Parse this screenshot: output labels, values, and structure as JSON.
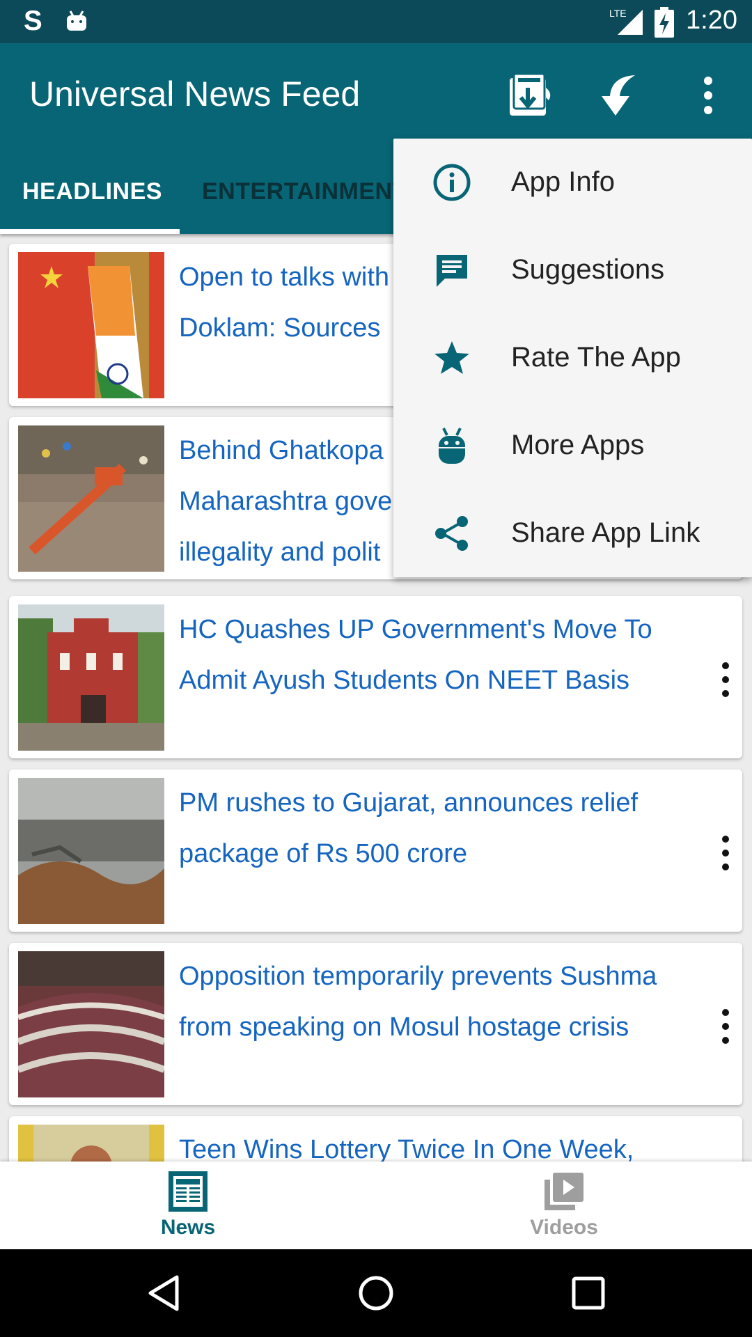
{
  "status_bar": {
    "left_glyph": "S",
    "network": "LTE",
    "time": "1:20"
  },
  "app_bar": {
    "title": "Universal News Feed"
  },
  "tabs": [
    {
      "label": "HEADLINES",
      "selected": true
    },
    {
      "label": "ENTERTAINMENT",
      "selected": false
    }
  ],
  "articles": [
    {
      "title": "Open to talks with China on Doklam: Sources",
      "visible_title": "Open to talks with\nDoklam: Sources"
    },
    {
      "title": "Behind Ghatkopa... Maharashtra gove... illegality and polit...",
      "visible_title": "Behind Ghatkopa\nMaharashtra gove\nillegality and polit"
    },
    {
      "title": "HC Quashes UP Government's Move To Admit Ayush Students On NEET Basis"
    },
    {
      "title": "PM rushes to Gujarat, announces relief package of Rs 500 crore"
    },
    {
      "title": "Opposition temporarily prevents Sushma from speaking on Mosul hostage crisis"
    },
    {
      "title": "Teen Wins Lottery Twice In One Week,"
    }
  ],
  "bottom_nav": [
    {
      "label": "News",
      "icon": "newspaper-icon",
      "selected": true
    },
    {
      "label": "Videos",
      "icon": "video-library-icon",
      "selected": false
    }
  ],
  "overflow_menu": [
    {
      "label": "App Info",
      "icon": "info-icon"
    },
    {
      "label": "Suggestions",
      "icon": "chat-icon"
    },
    {
      "label": "Rate The App",
      "icon": "star-icon"
    },
    {
      "label": "More Apps",
      "icon": "android-icon"
    },
    {
      "label": "Share App Link",
      "icon": "share-icon"
    }
  ],
  "colors": {
    "primary": "#086575",
    "status_bar": "#0c4a5a",
    "link": "#1565c0",
    "menu_icon": "#086575"
  }
}
